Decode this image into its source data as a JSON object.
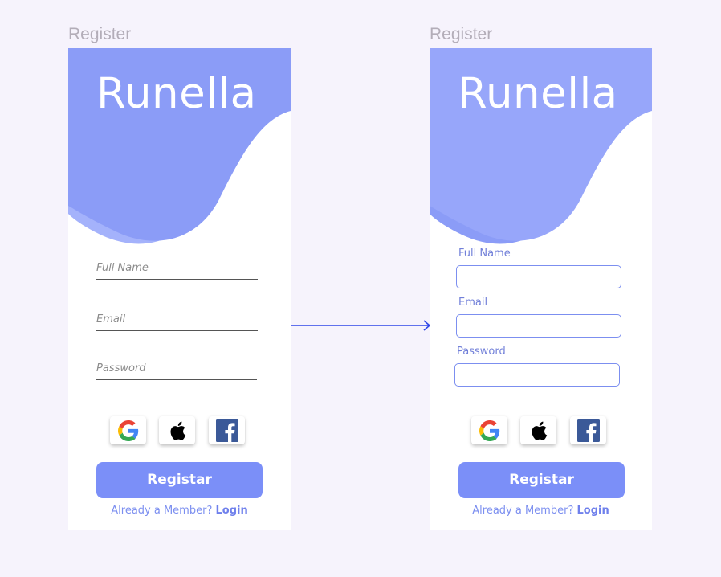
{
  "colors": {
    "background": "#f6f3fc",
    "wave_primary": "#8b9cf7",
    "wave_secondary": "#a4b2fb",
    "accent": "#7b8ff8",
    "arrow": "#2f46e8"
  },
  "screens": [
    {
      "frame_label": "Register",
      "logo": "Runella",
      "fields": [
        {
          "placeholder": "Full Name"
        },
        {
          "placeholder": "Email"
        },
        {
          "placeholder": "Password"
        }
      ],
      "social": [
        "google-icon",
        "apple-icon",
        "facebook-icon"
      ],
      "register_label": "Registar",
      "member_text": "Already a Member?",
      "login_link": "Login"
    },
    {
      "frame_label": "Register",
      "logo": "Runella",
      "fields": [
        {
          "label": "Full Name",
          "value": ""
        },
        {
          "label": "Email",
          "value": ""
        },
        {
          "label": "Password",
          "value": ""
        }
      ],
      "social": [
        "google-icon",
        "apple-icon",
        "facebook-icon"
      ],
      "register_label": "Registar",
      "member_text": "Already a Member?",
      "login_link": "Login"
    }
  ]
}
